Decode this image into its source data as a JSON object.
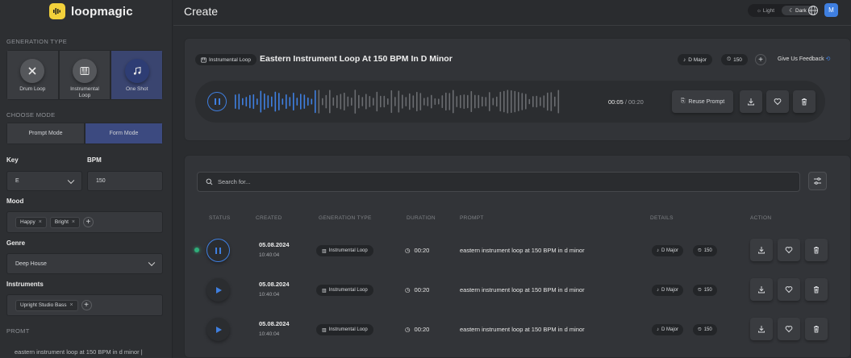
{
  "app": {
    "name": "loopmagic"
  },
  "sidebar": {
    "generation_type_label": "GENERATION TYPE",
    "generation_types": [
      {
        "label": "Drum Loop",
        "icon": "x-icon"
      },
      {
        "label": "Instrumental Loop",
        "icon": "piano-icon"
      },
      {
        "label": "One Shot",
        "icon": "music-note-icon",
        "selected": true
      }
    ],
    "mode_label": "CHOOSE MODE",
    "modes": [
      {
        "label": "Prompt Mode"
      },
      {
        "label": "Form Mode",
        "selected": true
      }
    ],
    "key_label": "Key",
    "key_value": "E",
    "bpm_label": "BPM",
    "bpm_value": "150",
    "mood_label": "Mood",
    "moods": [
      "Happy",
      "Bright"
    ],
    "genre_label": "Genre",
    "genre_value": "Deep House",
    "instruments_label": "Instruments",
    "instruments": [
      "Upright Studio Bass"
    ],
    "prompt_label": "PROMT",
    "prompt_value": "eastern instrument loop at 150 BPM in d minor |"
  },
  "header": {
    "title": "Create",
    "theme_light": "Light",
    "theme_dark": "Dark",
    "theme_selected": "dark",
    "avatar_initial": "M"
  },
  "player": {
    "badge": "Instrumental Loop",
    "title": "Eastern Instrument Loop At 150 BPM In D Minor",
    "key": "D Major",
    "bpm": "150",
    "feedback": "Give Us Feedback",
    "current_time": "00:05",
    "total_time": "/ 00:20",
    "reuse_label": "Reuse Prompt",
    "progress": 0.25
  },
  "list": {
    "search_placeholder": "Search for...",
    "columns": [
      "STATUS",
      "CREATED",
      "GENERATION TYPE",
      "DURATION",
      "PROMPT",
      "DETAILS",
      "ACTION"
    ],
    "rows": [
      {
        "date": "05.08.2024",
        "time": "10:40:04",
        "type": "Instrumental Loop",
        "duration": "00:20",
        "prompt": "eastern instrument loop at 150 BPM in d minor",
        "key": "D Major",
        "bpm": "150",
        "playing": true
      },
      {
        "date": "05.08.2024",
        "time": "10:40:04",
        "type": "Instrumental Loop",
        "duration": "00:20",
        "prompt": "eastern instrument loop at 150 BPM in d minor",
        "key": "D Major",
        "bpm": "150",
        "playing": false
      },
      {
        "date": "05.08.2024",
        "time": "10:40:04",
        "type": "Instrumental Loop",
        "duration": "00:20",
        "prompt": "eastern instrument loop at 150 BPM in d minor",
        "key": "D Major",
        "bpm": "150",
        "playing": false
      }
    ]
  },
  "colors": {
    "accent": "#3f7fe0",
    "logo": "#f2d13b",
    "status_active": "#2fae7a",
    "waveform_idle": "#6a6c70"
  }
}
